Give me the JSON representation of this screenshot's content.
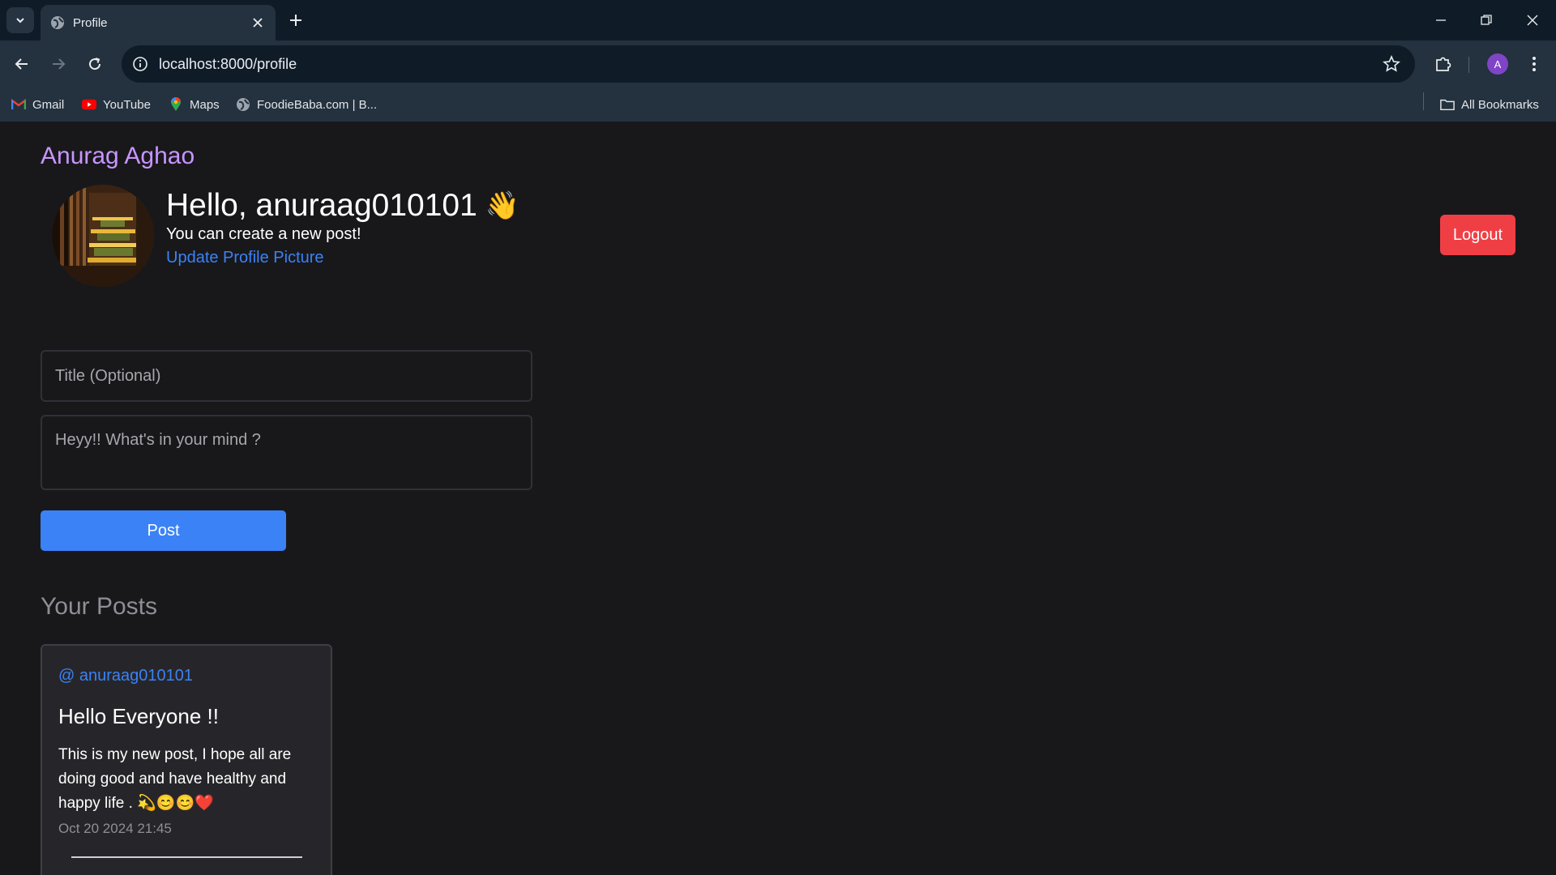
{
  "browser": {
    "tab_title": "Profile",
    "url": "localhost:8000/profile",
    "profile_initial": "A",
    "bookmarks": [
      {
        "label": "Gmail",
        "icon": "gmail-icon"
      },
      {
        "label": "YouTube",
        "icon": "youtube-icon"
      },
      {
        "label": "Maps",
        "icon": "maps-icon"
      },
      {
        "label": "FoodieBaba.com | B...",
        "icon": "globe-icon"
      }
    ],
    "all_bookmarks": "All Bookmarks"
  },
  "header": {
    "brand": "Anurag Aghao",
    "greeting": "Hello, anuraag010101",
    "wave": "👋",
    "subtext": "You can create a new post!",
    "update_link": "Update Profile Picture",
    "logout": "Logout"
  },
  "form": {
    "title_placeholder": "Title (Optional)",
    "body_placeholder": "Heyy!! What's in your mind ?",
    "post_button": "Post"
  },
  "posts": {
    "heading": "Your Posts",
    "items": [
      {
        "user": "@ anuraag010101",
        "title": "Hello Everyone !!",
        "body": "This is my new post, I hope all are doing good and have healthy and happy life . 💫😊😊❤️",
        "date": "Oct 20 2024 21:45"
      }
    ]
  },
  "colors": {
    "brand": "#c895ff",
    "link": "#3b82f6",
    "logout": "#ef3f45",
    "page_bg": "#18181b"
  }
}
